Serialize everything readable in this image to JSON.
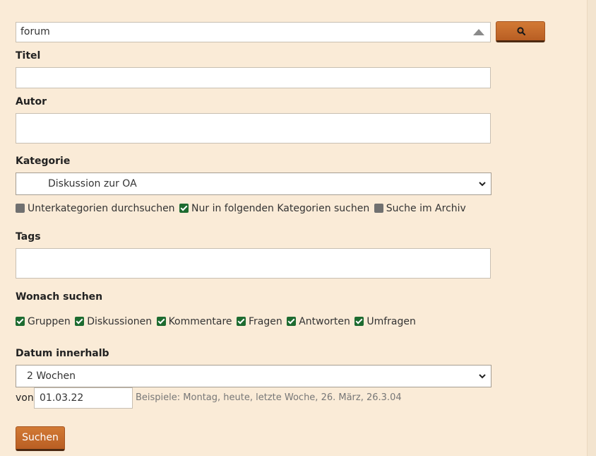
{
  "search": {
    "query": "forum",
    "button_icon": "search-icon"
  },
  "labels": {
    "title": "Titel",
    "author": "Autor",
    "category": "Kategorie",
    "tags": "Tags",
    "what": "Wonach suchen",
    "date": "Datum innerhalb",
    "from": "von"
  },
  "category": {
    "selected": "Diskussion zur OA",
    "options": [
      {
        "label": "Unterkategorien durchsuchen",
        "checked": false
      },
      {
        "label": "Nur in folgenden Kategorien suchen",
        "checked": true
      },
      {
        "label": "Suche im Archiv",
        "checked": false
      }
    ]
  },
  "types": [
    {
      "label": "Gruppen",
      "checked": true
    },
    {
      "label": "Diskussionen",
      "checked": true
    },
    {
      "label": "Kommentare",
      "checked": true
    },
    {
      "label": "Fragen",
      "checked": true
    },
    {
      "label": "Antworten",
      "checked": true
    },
    {
      "label": "Umfragen",
      "checked": true
    }
  ],
  "date": {
    "range": "2 Wochen",
    "from_value": "01.03.22",
    "hint": "Beispiele: Montag, heute, letzte Woche, 26. März, 26.3.04"
  },
  "submit_label": "Suchen",
  "colors": {
    "background": "#faebd7",
    "button": "#c46a2c",
    "checkbox_on": "#1d6b30",
    "checkbox_off": "#707070"
  }
}
